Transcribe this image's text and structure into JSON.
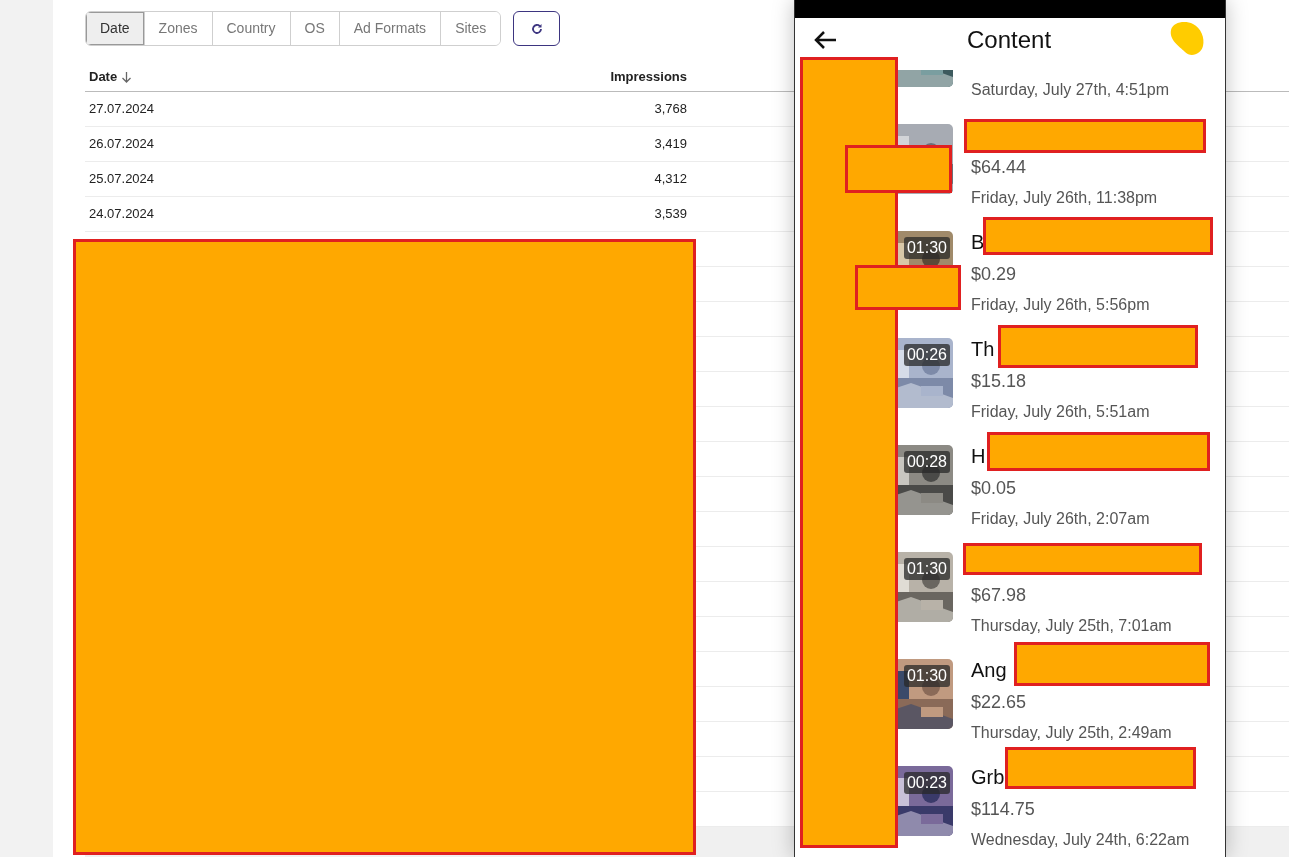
{
  "toolbar": {
    "tabs": [
      {
        "label": "Date",
        "selected": true
      },
      {
        "label": "Zones",
        "selected": false
      },
      {
        "label": "Country",
        "selected": false
      },
      {
        "label": "OS",
        "selected": false
      },
      {
        "label": "Ad Formats",
        "selected": false
      },
      {
        "label": "Sites",
        "selected": false
      }
    ]
  },
  "table": {
    "columns": [
      "Date",
      "Impressions"
    ],
    "rows": [
      [
        "27.07.2024",
        "3,768"
      ],
      [
        "26.07.2024",
        "3,419"
      ],
      [
        "25.07.2024",
        "4,312"
      ],
      [
        "24.07.2024",
        "3,539"
      ]
    ]
  },
  "phone": {
    "title": "Content",
    "items": [
      {
        "kind": "partial",
        "date": "Saturday, July 27th, 4:51pm"
      },
      {
        "kind": "full",
        "price": "$64.44",
        "date": "Friday, July 26th, 11:38pm"
      },
      {
        "kind": "full",
        "duration": "01:30",
        "title": "B",
        "price": "$0.29",
        "date": "Friday, July 26th, 5:56pm"
      },
      {
        "kind": "full",
        "duration": "00:26",
        "title": "Th",
        "price": "$15.18",
        "date": "Friday, July 26th, 5:51am"
      },
      {
        "kind": "full",
        "duration": "00:28",
        "title": "H",
        "price": "$0.05",
        "date": "Friday, July 26th, 2:07am"
      },
      {
        "kind": "full",
        "duration": "01:30",
        "price": "$67.98",
        "date": "Thursday, July 25th, 7:01am"
      },
      {
        "kind": "full",
        "duration": "01:30",
        "title": "Ang",
        "price": "$22.65",
        "date": "Thursday, July 25th, 2:49am"
      },
      {
        "kind": "full",
        "duration": "00:23",
        "title": "Grb",
        "price": "$114.75",
        "date": "Wednesday, July 24th, 6:22am"
      }
    ]
  }
}
